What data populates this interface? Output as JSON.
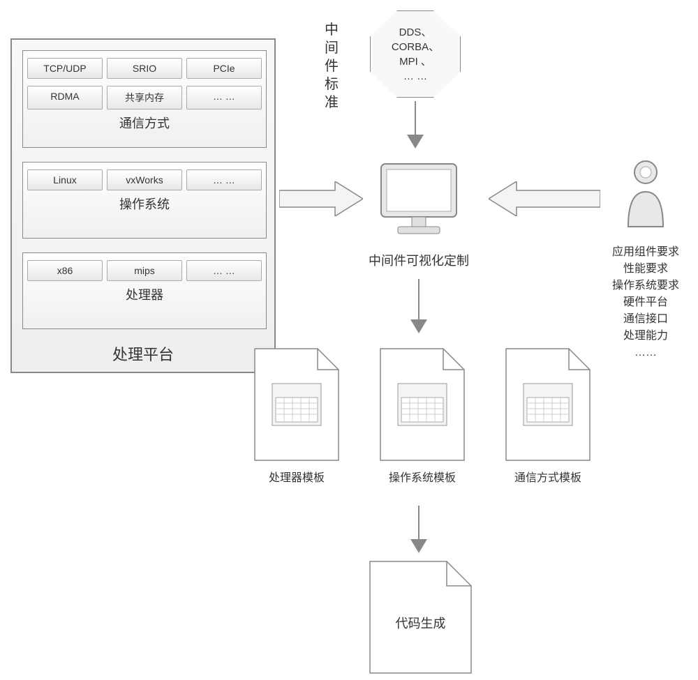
{
  "platform": {
    "title": "处理平台",
    "groups": {
      "comm": {
        "title": "通信方式",
        "row1": [
          "TCP/UDP",
          "SRIO",
          "PCIe"
        ],
        "row2": [
          "RDMA",
          "共享内存",
          "… …"
        ]
      },
      "os": {
        "title": "操作系统",
        "row1": [
          "Linux",
          "vxWorks",
          "… …"
        ]
      },
      "proc": {
        "title": "处理器",
        "row1": [
          "x86",
          "mips",
          "… …"
        ]
      }
    }
  },
  "middleware_standards": {
    "vert_label": "中间件标准",
    "octagon": "DDS、\nCORBA、\nMPI 、\n… …"
  },
  "center": {
    "label": "中间件可视化定制"
  },
  "requirements": {
    "lines": [
      "应用组件要求",
      "性能要求",
      "操作系统要求",
      "硬件平台",
      "通信接口",
      "处理能力",
      "……"
    ]
  },
  "templates": {
    "items": [
      {
        "label": "处理器模板"
      },
      {
        "label": "操作系统模板"
      },
      {
        "label": "通信方式模板"
      }
    ]
  },
  "codegen": {
    "label": "代码生成"
  }
}
